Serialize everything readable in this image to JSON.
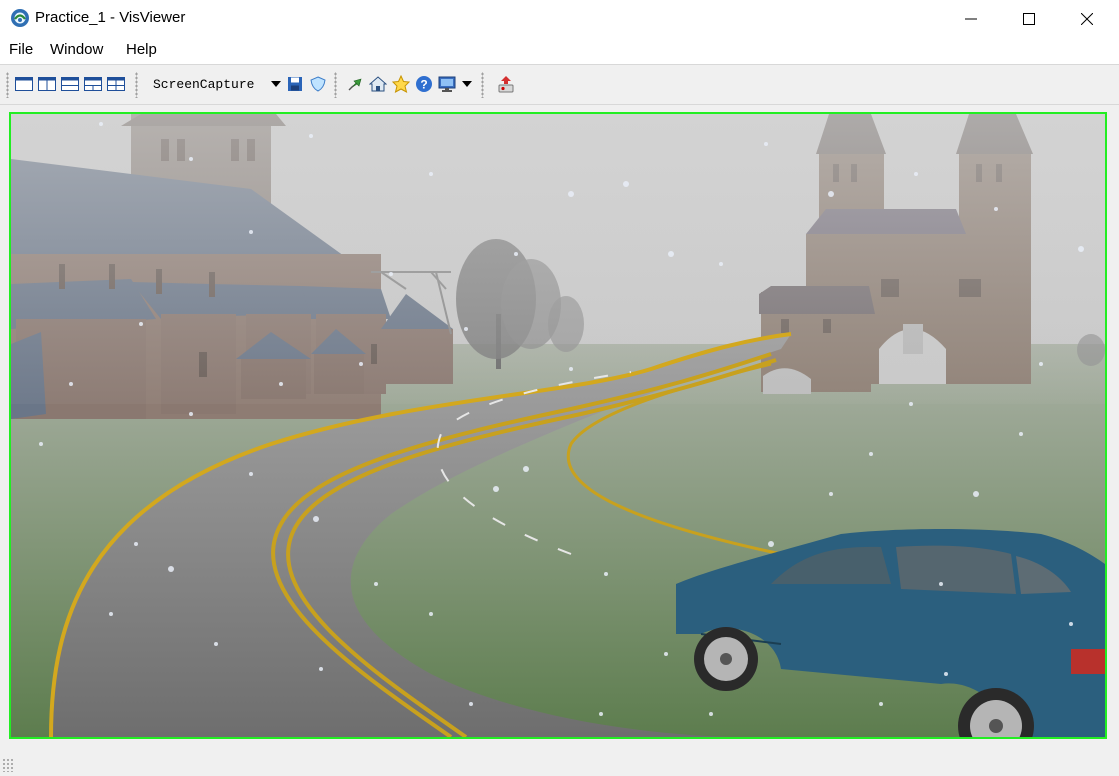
{
  "window": {
    "title": "Practice_1 - VisViewer"
  },
  "menu": {
    "items": [
      "File",
      "Window",
      "Help"
    ]
  },
  "toolbar": {
    "capture_label": "ScreenCapture"
  },
  "colors": {
    "viewport_border": "#22ee22",
    "road": "#7d7d7d",
    "road_line": "#d3a81e",
    "grass": "#6f8a5c",
    "car": "#2b5f7e",
    "sky": "#d0d0d0"
  }
}
